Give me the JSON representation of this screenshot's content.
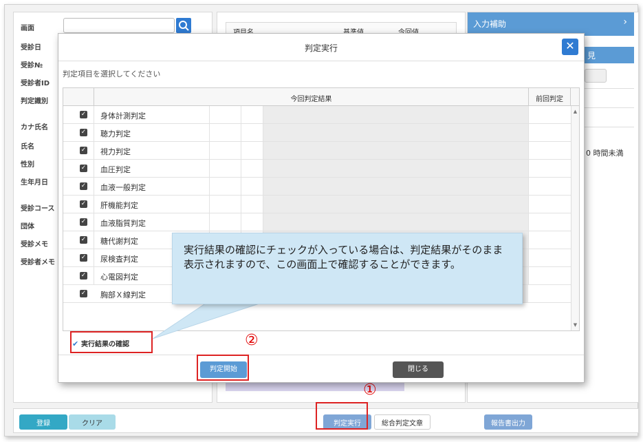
{
  "left_labels": [
    "画面",
    "受診日",
    "受診№",
    "受診者ID",
    "判定識別",
    "カナ氏名",
    "氏名",
    "性別",
    "生年月日",
    "受診コース",
    "団体",
    "受診メモ",
    "受診者メモ"
  ],
  "mid_header": {
    "col1": "項目名",
    "col2": "基準値",
    "col3": "今回値"
  },
  "right": {
    "assist_title": "入力補助",
    "assist_chevron": "›",
    "sub_title": "見",
    "text_fragment": "0 時間未満"
  },
  "bottom": {
    "register": "登録",
    "clear": "クリア",
    "execute": "判定実行",
    "summary": "総合判定文章",
    "report": "報告書出力"
  },
  "modal": {
    "title": "判定実行",
    "close": "✕",
    "instruction": "判定項目を選択してください",
    "col_current": "今回判定結果",
    "col_previous": "前回判定",
    "items": [
      "身体計測判定",
      "聴力判定",
      "視力判定",
      "血圧判定",
      "血液一般判定",
      "肝機能判定",
      "血液脂質判定",
      "糖代謝判定",
      "尿検査判定",
      "心電図判定",
      "胸部Ｘ線判定"
    ],
    "confirm_label": "実行結果の確認",
    "start_button": "判定開始",
    "close_button": "閉じる"
  },
  "callout_text": "実行結果の確認にチェックが入っている場合は、判定結果がそのまま表示されますので、この画面上で確認することができます。",
  "markers": {
    "one": "①",
    "two": "②"
  }
}
